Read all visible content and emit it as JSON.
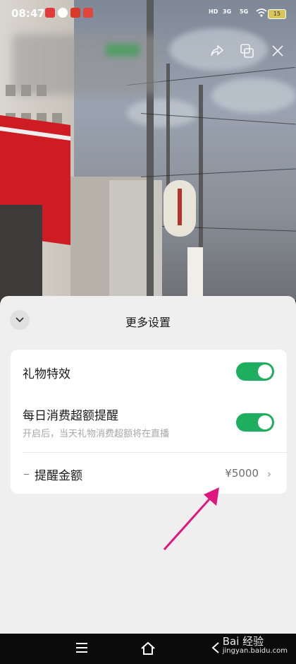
{
  "status_bar": {
    "time": "08:47",
    "network": [
      "HD",
      "3G",
      "5G"
    ],
    "battery": "15"
  },
  "sheet": {
    "title": "更多设置",
    "gift_effect_label": "礼物特效",
    "gift_effect_on": true,
    "daily_reminder_label": "每日消费超额提醒",
    "daily_reminder_desc": "开启后，当天礼物消费超额将在直播",
    "daily_reminder_on": true,
    "amount_label": "提醒金额",
    "amount_value": "¥5000"
  },
  "watermark": {
    "brand": "Bai 经验",
    "url": "jingyan.baidu.com"
  },
  "colors": {
    "accent_green": "#1fad5f",
    "arrow_pink": "#e0167f"
  },
  "icons": [
    "share-icon",
    "pip-icon",
    "close-icon",
    "chevron-down-icon",
    "chevron-right-icon",
    "menu-icon",
    "home-icon",
    "back-icon"
  ]
}
